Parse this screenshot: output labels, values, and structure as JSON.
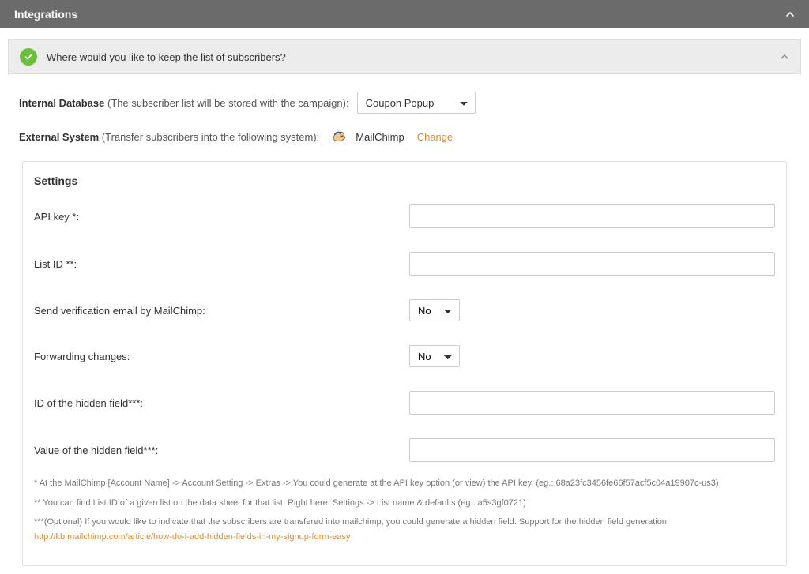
{
  "header": {
    "title": "Integrations"
  },
  "banner": {
    "text": "Where would you like to keep the list of subscribers?"
  },
  "internal_db": {
    "label_bold": "Internal Database",
    "label_rest": " (The subscriber list will be stored with the campaign):",
    "select_value": "Coupon Popup"
  },
  "external_system": {
    "label_bold": "External System",
    "label_rest": " (Transfer subscribers into the following system):",
    "provider": "MailChimp",
    "change": "Change"
  },
  "settings": {
    "title": "Settings",
    "fields": {
      "api_key": {
        "label": "API key *:",
        "value": ""
      },
      "list_id": {
        "label": "List ID **:",
        "value": ""
      },
      "verify_email": {
        "label": "Send verification email by MailChimp:",
        "value": "No"
      },
      "forwarding": {
        "label": "Forwarding changes:",
        "value": "No"
      },
      "hidden_id": {
        "label": "ID of the hidden field***:",
        "value": ""
      },
      "hidden_value": {
        "label": "Value of the hidden field***:",
        "value": ""
      }
    },
    "footnotes": {
      "n1": "* At the MailChimp [Account Name] -> Account Setting -> Extras -> You could generate at the API key option (or view) the API key. (eg.: 68a23fc3456fe66f57acf5c04a19907c-us3)",
      "n2": "** You can find List ID of a given list on the data sheet for that list. Right here: Settings -> List name & defaults (eg.: a5s3gf0721)",
      "n3a": "***(Optional) If you would like to indicate that the subscribers are transfered into mailchimp, you could generate a hidden field. Support for the hidden field generation: ",
      "n3_link": "http://kb.mailchimp.com/article/how-do-i-add-hidden-fields-in-my-signup-form-easy"
    }
  }
}
